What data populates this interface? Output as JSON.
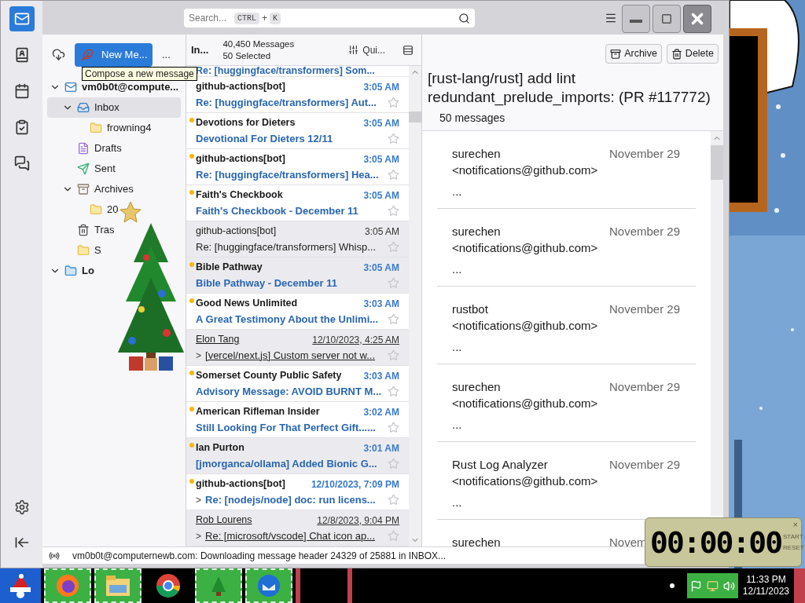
{
  "spaces": [
    {
      "kind": "mail",
      "selected": true
    },
    {
      "kind": "address-book",
      "selected": false
    },
    {
      "kind": "calendar",
      "selected": false
    },
    {
      "kind": "tasks",
      "selected": false
    },
    {
      "kind": "chat",
      "selected": false
    }
  ],
  "search": {
    "placeholder": "Search...",
    "keys": [
      "CTRL",
      "K"
    ],
    "joiner": "+"
  },
  "folder_pane": {
    "new_message": "New Me...",
    "more": "...",
    "tooltip": "Compose a new message",
    "folders": [
      {
        "name": "vm0b0t@compute...",
        "kind": "account",
        "bold": true,
        "expanded": true,
        "selected": false,
        "children": [
          {
            "name": "Inbox",
            "kind": "inbox",
            "expanded": true,
            "selected": true,
            "children": [
              {
                "name": "frowning4",
                "kind": "folder",
                "selected": false
              }
            ]
          },
          {
            "name": "Drafts",
            "kind": "drafts",
            "selected": false
          },
          {
            "name": "Sent",
            "kind": "sent",
            "selected": false
          },
          {
            "name": "Archives",
            "kind": "archive",
            "expanded": true,
            "selected": false,
            "children": [
              {
                "name": "20",
                "kind": "folder",
                "selected": false
              }
            ]
          },
          {
            "name": "Tras",
            "kind": "trash",
            "selected": false
          },
          {
            "name": "S",
            "kind": "folder",
            "selected": false
          }
        ]
      },
      {
        "name": "Lo",
        "kind": "local",
        "bold": true,
        "expanded": true,
        "selected": false
      }
    ]
  },
  "message_list": {
    "folder": "In...",
    "count": "40,450 Messages",
    "selected_count": "50 Selected",
    "quick_filter": "Qui...",
    "partial_subject": "Re: [huggingface/transformers] Som...",
    "messages": [
      {
        "sender": "github-actions[bot]",
        "time": "3:05 AM",
        "subject": "Re: [huggingface/transformers] Aut...",
        "unread": true,
        "dot": false,
        "selected": false,
        "underlined": false
      },
      {
        "sender": "Devotions for Dieters",
        "time": "3:05 AM",
        "subject": "Devotional For Dieters 12/11",
        "unread": true,
        "dot": true,
        "selected": false,
        "underlined": false
      },
      {
        "sender": "github-actions[bot]",
        "time": "3:05 AM",
        "subject": "Re: [huggingface/transformers] Hea...",
        "unread": true,
        "dot": true,
        "selected": false,
        "underlined": false
      },
      {
        "sender": "Faith's Checkbook",
        "time": "3:05 AM",
        "subject": "Faith's Checkbook - December 11",
        "unread": true,
        "dot": true,
        "selected": false,
        "underlined": false
      },
      {
        "sender": "github-actions[bot]",
        "time": "3:05 AM",
        "subject": "Re: [huggingface/transformers] Whisp...",
        "unread": false,
        "dot": false,
        "selected": true,
        "underlined": false
      },
      {
        "sender": "Bible Pathway",
        "time": "3:05 AM",
        "subject": "Bible Pathway - December 11",
        "unread": true,
        "dot": true,
        "selected": true,
        "underlined": false
      },
      {
        "sender": "Good News Unlimited",
        "time": "3:03 AM",
        "subject": "A Great Testimony About the Unlimi...",
        "unread": true,
        "dot": true,
        "selected": false,
        "underlined": false
      },
      {
        "sender": "Elon Tang",
        "time": "12/10/2023, 4:25 AM",
        "subject": "[vercel/next.js] Custom server not w...",
        "twisty": ">",
        "unread": false,
        "dot": false,
        "selected": true,
        "underlined": true
      },
      {
        "sender": "Somerset County Public Safety",
        "time": "3:03 AM",
        "subject": "Advisory Message: AVOID BURNT M...",
        "unread": true,
        "dot": true,
        "selected": false,
        "underlined": false
      },
      {
        "sender": "American Rifleman Insider",
        "time": "3:02 AM",
        "subject": "Still Looking For That Perfect Gift......",
        "unread": true,
        "dot": true,
        "selected": false,
        "underlined": false
      },
      {
        "sender": "Ian Purton",
        "time": "3:01 AM",
        "subject": "[jmorganca/ollama] Added Bionic G...",
        "unread": true,
        "dot": true,
        "selected": true,
        "underlined": false
      },
      {
        "sender": "github-actions[bot]",
        "time": "12/10/2023, 7:09 PM",
        "subject": "Re: [nodejs/node] doc: run licens...",
        "twisty": ">",
        "unread": true,
        "dot": true,
        "selected": false,
        "underlined": false
      },
      {
        "sender": "Rob Lourens",
        "time": "12/8/2023, 9:04 PM",
        "subject": "Re: [microsoft/vscode] Chat icon ap...",
        "twisty": ">",
        "unread": false,
        "dot": false,
        "selected": true,
        "underlined": true
      }
    ]
  },
  "thread": {
    "buttons": [
      {
        "kind": "archive",
        "label": "Archive"
      },
      {
        "kind": "delete",
        "label": "Delete"
      }
    ],
    "subject": "[rust-lang/rust] add lint redundant_prelude_imports: (PR #117772)",
    "count": "50 messages",
    "messages": [
      {
        "sender": "surechen",
        "email": "<notifications@github.com>",
        "date": "November 29",
        "preview": "..."
      },
      {
        "sender": "surechen",
        "email": "<notifications@github.com>",
        "date": "November 29",
        "preview": "..."
      },
      {
        "sender": "rustbot",
        "email": "<notifications@github.com>",
        "date": "November 29",
        "preview": "..."
      },
      {
        "sender": "surechen",
        "email": "<notifications@github.com>",
        "date": "November 29",
        "preview": "..."
      },
      {
        "sender": "Rust Log Analyzer",
        "email": "<notifications@github.com>",
        "date": "November 29",
        "preview": "..."
      },
      {
        "sender": "surechen",
        "date": "Novem"
      }
    ]
  },
  "status_bar": {
    "text": "vm0b0t@computernewb.com: Downloading message header 24329 of 25881 in INBOX..."
  },
  "timer": {
    "time": "00:00:00",
    "start": "START",
    "reset": "RESET",
    "close": "×"
  },
  "taskbar": {
    "apps": [
      {
        "kind": "firefox",
        "highlighted": true
      },
      {
        "kind": "explorer",
        "highlighted": true
      },
      {
        "kind": "chrome",
        "highlighted": false
      },
      {
        "kind": "tree",
        "highlighted": true
      },
      {
        "kind": "thunderbird",
        "highlighted": true
      }
    ],
    "time": "11:33 PM",
    "date": "12/11/2023"
  }
}
